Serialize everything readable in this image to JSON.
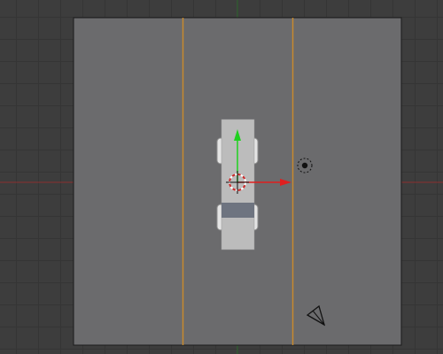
{
  "viewport": {
    "background": "#3d3d3d",
    "grid_color": "#353535",
    "x_axis_color": "#8a3030",
    "y_axis_color": "#2e6a2e",
    "plane_color": "#6b6b6d",
    "plane_edge_color": "#1a1a1a",
    "road_line_color": "#c78a2e",
    "vehicle_body_color": "#bcbcbc",
    "vehicle_stripe_color": "#6e7480",
    "gizmo_x_color": "#e01f1f",
    "gizmo_y_color": "#1fd11f",
    "icons": [
      "3d-cursor-icon",
      "light-icon",
      "camera-icon"
    ]
  }
}
